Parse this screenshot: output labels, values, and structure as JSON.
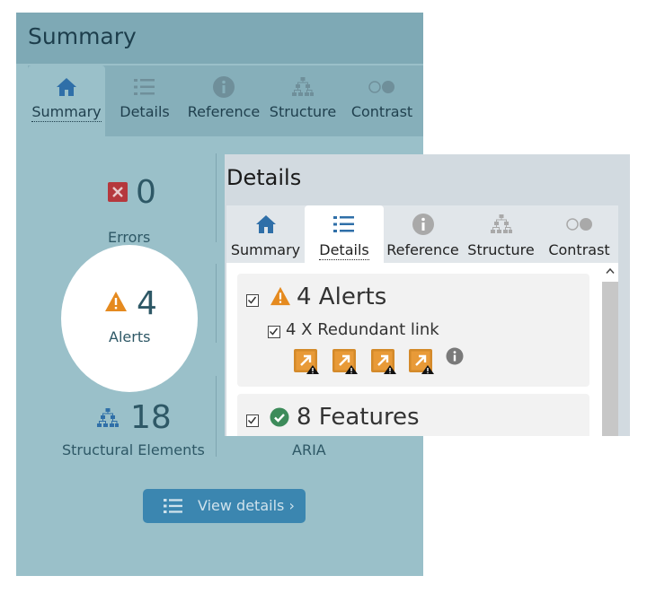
{
  "summary": {
    "title": "Summary",
    "tabs": [
      {
        "label": "Summary",
        "icon": "home-icon",
        "active": true
      },
      {
        "label": "Details",
        "icon": "list-icon",
        "active": false
      },
      {
        "label": "Reference",
        "icon": "info-icon",
        "active": false
      },
      {
        "label": "Structure",
        "icon": "hierarchy-icon",
        "active": false
      },
      {
        "label": "Contrast",
        "icon": "contrast-icon",
        "active": false
      }
    ],
    "stats": {
      "errors": {
        "count": "0",
        "label": "Errors"
      },
      "alerts": {
        "count": "4",
        "label": "Alerts"
      },
      "structural": {
        "count": "18",
        "label": "Structural Elements"
      },
      "aria": {
        "label": "ARIA"
      }
    },
    "view_details_label": "View details ›"
  },
  "details": {
    "title": "Details",
    "tabs": [
      {
        "label": "Summary",
        "icon": "home-icon",
        "active": false
      },
      {
        "label": "Details",
        "icon": "list-icon",
        "active": true
      },
      {
        "label": "Reference",
        "icon": "info-icon",
        "active": false
      },
      {
        "label": "Structure",
        "icon": "hierarchy-icon",
        "active": false
      },
      {
        "label": "Contrast",
        "icon": "contrast-icon",
        "active": false
      }
    ],
    "alerts_group": {
      "label": "4 Alerts",
      "checked": true
    },
    "redundant_link": {
      "label": "4 X Redundant link",
      "checked": true
    },
    "features_group": {
      "label": "8 Features",
      "checked": true
    }
  },
  "colors": {
    "alert_orange": "#e58a1f",
    "success_green": "#3d8b5a",
    "home_blue": "#2f6fa8",
    "error_red": "#b5383d",
    "button_blue": "#3b86b0"
  }
}
